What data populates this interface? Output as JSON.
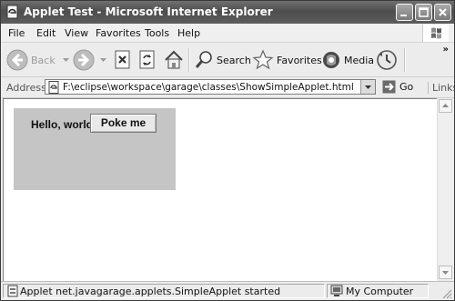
{
  "window": {
    "title": "Applet Test - Microsoft Internet Explorer",
    "icon": "ie-page-icon",
    "controls": [
      "minimize-icon",
      "maximize-icon",
      "close-icon"
    ]
  },
  "menubar": {
    "items": [
      {
        "label": "File"
      },
      {
        "label": "Edit"
      },
      {
        "label": "View"
      },
      {
        "label": "Favorites"
      },
      {
        "label": "Tools"
      },
      {
        "label": "Help"
      }
    ]
  },
  "toolbar": {
    "back_label": "Back",
    "search_label": "Search",
    "favorites_label": "Favorites",
    "media_label": "Media",
    "more": "»"
  },
  "address": {
    "label": "Address",
    "url": "F:\\eclipse\\workspace\\garage\\classes\\ShowSimpleApplet.html",
    "go_label": "Go",
    "links_label": "Links"
  },
  "applet": {
    "text": "Hello, world",
    "button_label": "Poke me"
  },
  "status": {
    "message": "Applet net.javagarage.applets.SimpleApplet started",
    "zone": "My Computer"
  },
  "colors": {
    "titlebar": "#5a5a5a",
    "applet_background": "#c5c5c5"
  }
}
